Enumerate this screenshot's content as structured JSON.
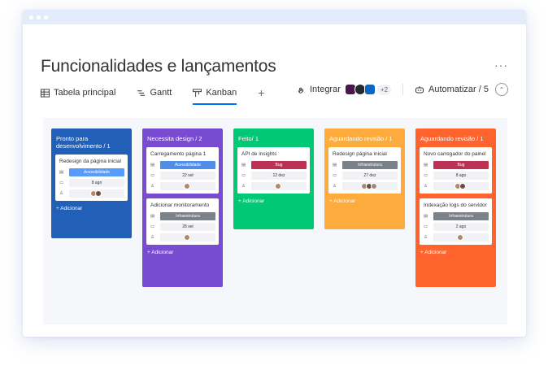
{
  "page": {
    "title": "Funcionalidades e lançamentos",
    "more": "···"
  },
  "tabs": [
    {
      "label": "Tabela principal",
      "icon": "table-icon"
    },
    {
      "label": "Gantt",
      "icon": "gantt-icon"
    },
    {
      "label": "Kanban",
      "icon": "kanban-icon",
      "active": true
    }
  ],
  "add_tab": "+",
  "tools": {
    "integrate": "Integrar",
    "integrate_extra": "+2",
    "automate": "Automatizar / 5",
    "collapse": "⌃"
  },
  "columns": [
    {
      "title": "Pronto para desenvolvimento / 1",
      "color": "#225fb7",
      "cards": [
        {
          "title": "Redesign da página inicial",
          "tag": "Acessibilidade",
          "tag_color": "#579bfc",
          "date": "8 ago",
          "people": 2
        }
      ],
      "add": "+ Adicionar"
    },
    {
      "title": "Necessita design / 2",
      "color": "#784bd1",
      "cards": [
        {
          "title": "Carregamento página 1",
          "tag": "Acessibilidade",
          "tag_color": "#4f8ee8",
          "date": "22 set",
          "people": 1
        },
        {
          "title": "Adicionar monitoramento",
          "tag": "Infraestrutura",
          "tag_color": "#7a8189",
          "date": "28 set",
          "people": 1
        }
      ],
      "add": "+ Adicionar"
    },
    {
      "title": "Feito/ 1",
      "color": "#00c875",
      "cards": [
        {
          "title": "API de insights",
          "tag": "Bug",
          "tag_color": "#bb3354",
          "date": "12 dez",
          "people": 1
        }
      ],
      "add": "+ Adicionar"
    },
    {
      "title": "Aguardando revisão / 1",
      "color": "#fdab3d",
      "cards": [
        {
          "title": "Redesign página inicial",
          "tag": "Infraestrutura",
          "tag_color": "#7a8189",
          "date": "27 dez",
          "people": 3
        }
      ],
      "add": "+ Adicionar"
    },
    {
      "title": "Aguardando revisão / 1",
      "color": "#ff642e",
      "cards": [
        {
          "title": "Novo carregador do painel",
          "tag": "Bug",
          "tag_color": "#bb3354",
          "date": "8 ago",
          "people": 2
        },
        {
          "title": "Indexação logs do servidor",
          "tag": "Infraestrutura",
          "tag_color": "#7a8189",
          "date": "2 ago",
          "people": 1
        }
      ],
      "add": "+ Adicionar"
    }
  ]
}
